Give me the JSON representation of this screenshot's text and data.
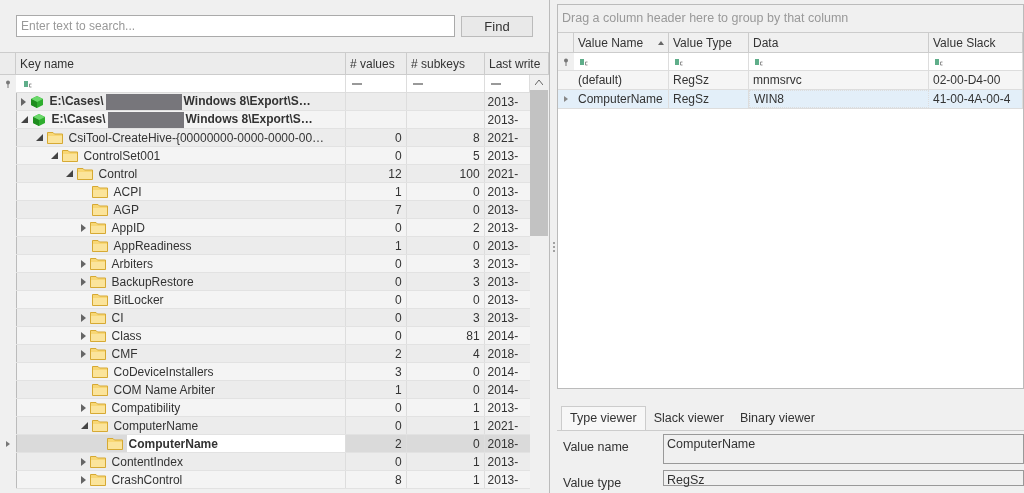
{
  "search": {
    "placeholder": "Enter text to search...",
    "button": "Find"
  },
  "key_tree": {
    "columns": [
      {
        "label": "Key name"
      },
      {
        "label": "# values"
      },
      {
        "label": "# subkeys"
      },
      {
        "label": "Last write"
      }
    ],
    "rows": [
      {
        "kind": "hive",
        "name": "E:\\Cases\\",
        "name_tail": "Windows 8\\Export\\S…",
        "expanded": false,
        "selected": false,
        "last_write": "2013-"
      },
      {
        "kind": "hive",
        "name": "E:\\Cases\\",
        "name_tail": "Windows 8\\Export\\S…",
        "expanded": true,
        "selected": false,
        "last_write": "2013-",
        "children": [
          {
            "kind": "folder",
            "name": "CsiTool-CreateHive-{00000000-0000-0000-00…",
            "expanded": true,
            "selected": false,
            "values": "0",
            "subkeys": "8",
            "last_write": "2021-",
            "children": [
              {
                "kind": "folder",
                "name": "ControlSet001",
                "expanded": true,
                "selected": false,
                "values": "0",
                "subkeys": "5",
                "last_write": "2013-",
                "children": [
                  {
                    "kind": "folder",
                    "name": "Control",
                    "expanded": true,
                    "selected": false,
                    "values": "12",
                    "subkeys": "100",
                    "last_write": "2021-",
                    "children": [
                      {
                        "kind": "folder",
                        "name": "ACPI",
                        "selected": false,
                        "values": "1",
                        "subkeys": "0",
                        "last_write": "2013-"
                      },
                      {
                        "kind": "folder",
                        "name": "AGP",
                        "selected": false,
                        "values": "7",
                        "subkeys": "0",
                        "last_write": "2013-"
                      },
                      {
                        "kind": "folder",
                        "name": "AppID",
                        "expanded": false,
                        "selected": false,
                        "values": "0",
                        "subkeys": "2",
                        "last_write": "2013-"
                      },
                      {
                        "kind": "folder",
                        "name": "AppReadiness",
                        "selected": false,
                        "values": "1",
                        "subkeys": "0",
                        "last_write": "2013-"
                      },
                      {
                        "kind": "folder",
                        "name": "Arbiters",
                        "expanded": false,
                        "selected": false,
                        "values": "0",
                        "subkeys": "3",
                        "last_write": "2013-"
                      },
                      {
                        "kind": "folder",
                        "name": "BackupRestore",
                        "expanded": false,
                        "selected": false,
                        "values": "0",
                        "subkeys": "3",
                        "last_write": "2013-"
                      },
                      {
                        "kind": "folder",
                        "name": "BitLocker",
                        "selected": false,
                        "values": "0",
                        "subkeys": "0",
                        "last_write": "2013-"
                      },
                      {
                        "kind": "folder",
                        "name": "CI",
                        "expanded": false,
                        "selected": false,
                        "values": "0",
                        "subkeys": "3",
                        "last_write": "2013-"
                      },
                      {
                        "kind": "folder",
                        "name": "Class",
                        "expanded": false,
                        "selected": false,
                        "values": "0",
                        "subkeys": "81",
                        "last_write": "2014-"
                      },
                      {
                        "kind": "folder",
                        "name": "CMF",
                        "expanded": false,
                        "selected": false,
                        "values": "2",
                        "subkeys": "4",
                        "last_write": "2018-"
                      },
                      {
                        "kind": "folder",
                        "name": "CoDeviceInstallers",
                        "selected": false,
                        "values": "3",
                        "subkeys": "0",
                        "last_write": "2014-"
                      },
                      {
                        "kind": "folder",
                        "name": "COM Name Arbiter",
                        "selected": false,
                        "values": "1",
                        "subkeys": "0",
                        "last_write": "2014-"
                      },
                      {
                        "kind": "folder",
                        "name": "Compatibility",
                        "expanded": false,
                        "selected": false,
                        "values": "0",
                        "subkeys": "1",
                        "last_write": "2013-"
                      },
                      {
                        "kind": "folder",
                        "name": "ComputerName",
                        "expanded": true,
                        "selected": false,
                        "values": "0",
                        "subkeys": "1",
                        "last_write": "2021-",
                        "children": [
                          {
                            "kind": "folder",
                            "name": "ComputerName",
                            "selected": true,
                            "values": "2",
                            "subkeys": "0",
                            "last_write": "2018-"
                          }
                        ]
                      },
                      {
                        "kind": "folder",
                        "name": "ContentIndex",
                        "expanded": false,
                        "selected": false,
                        "values": "0",
                        "subkeys": "1",
                        "last_write": "2013-"
                      },
                      {
                        "kind": "folder",
                        "name": "CrashControl",
                        "expanded": false,
                        "selected": false,
                        "values": "8",
                        "subkeys": "1",
                        "last_write": "2013-"
                      }
                    ]
                  }
                ]
              }
            ]
          }
        ]
      }
    ]
  },
  "values_grid": {
    "group_hint": "Drag a column header here to group by that column",
    "columns": [
      {
        "label": "Value Name",
        "sorted": true
      },
      {
        "label": "Value Type",
        "sorted": false
      },
      {
        "label": "Data",
        "sorted": false
      },
      {
        "label": "Value Slack",
        "sorted": false
      }
    ],
    "rows": [
      {
        "name": "(default)",
        "type": "RegSz",
        "data": "mnmsrvc",
        "slack": "02-00-D4-00",
        "selected": false
      },
      {
        "name": "ComputerName",
        "type": "RegSz",
        "data": "WIN8",
        "slack": "41-00-4A-00-4",
        "selected": true
      }
    ]
  },
  "viewer": {
    "tabs": [
      {
        "label": "Type viewer",
        "selected": true
      },
      {
        "label": "Slack viewer",
        "selected": false
      },
      {
        "label": "Binary viewer",
        "selected": false
      }
    ],
    "fields": [
      {
        "label": "Value name",
        "value": "ComputerName"
      },
      {
        "label": "Value type",
        "value": "RegSz"
      }
    ]
  }
}
